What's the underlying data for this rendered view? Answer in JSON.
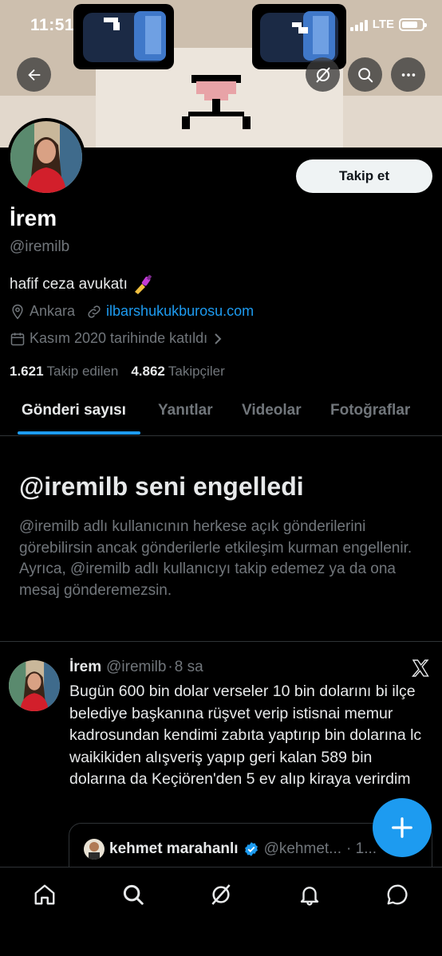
{
  "status_bar": {
    "time": "11:51",
    "network": "LTE"
  },
  "profile": {
    "display_name": "İrem",
    "handle": "@iremilb",
    "bio": "hafif ceza avukatı",
    "bio_emoji": "nail-polish-emoji",
    "location": "Ankara",
    "website": "ilbarshukukburosu.com",
    "joined": "Kasım 2020 tarihinde katıldı",
    "following_count": "1.621",
    "following_label": "Takip edilen",
    "followers_count": "4.862",
    "followers_label": "Takipçiler",
    "follow_button": "Takip et"
  },
  "tabs": [
    {
      "label": "Gönderi sayısı",
      "active": true
    },
    {
      "label": "Yanıtlar",
      "active": false
    },
    {
      "label": "Videolar",
      "active": false
    },
    {
      "label": "Fotoğraflar",
      "active": false
    }
  ],
  "blocked_notice": {
    "title": "@iremilb seni engelledi",
    "text": "@iremilb adlı kullanıcının herkese açık gönderilerini görebilirsin ancak gönderilerle etkileşim kurman engellenir. Ayrıca, @iremilb adlı kullanıcıyı takip edemez ya da ona mesaj gönderemezsin."
  },
  "tweet": {
    "author_name": "İrem",
    "author_handle": "@iremilb",
    "separator": "·",
    "time": "8 sa",
    "text": "Bugün 600 bin dolar verseler 10 bin dolarını bi ilçe belediye başkanına rüşvet verip istisnai memur kadrosundan kendimi zabıta yaptırıp bin dolarına lc waikikiden alışveriş yapıp geri kalan 589 bin dolarına da Keçiören'den 5 ev alıp kiraya verirdim",
    "quote": {
      "author_name": "kehmet marahanlı",
      "verified": true,
      "author_handle": "@kehmet...",
      "trailing": "· 1..."
    }
  },
  "bottom_nav": [
    "home-icon",
    "search-icon",
    "grok-icon",
    "notifications-icon",
    "messages-icon"
  ],
  "colors": {
    "accent": "#1d9bf0",
    "background": "#000000",
    "secondary_text": "#71767b",
    "primary_text": "#e7e9ea"
  }
}
